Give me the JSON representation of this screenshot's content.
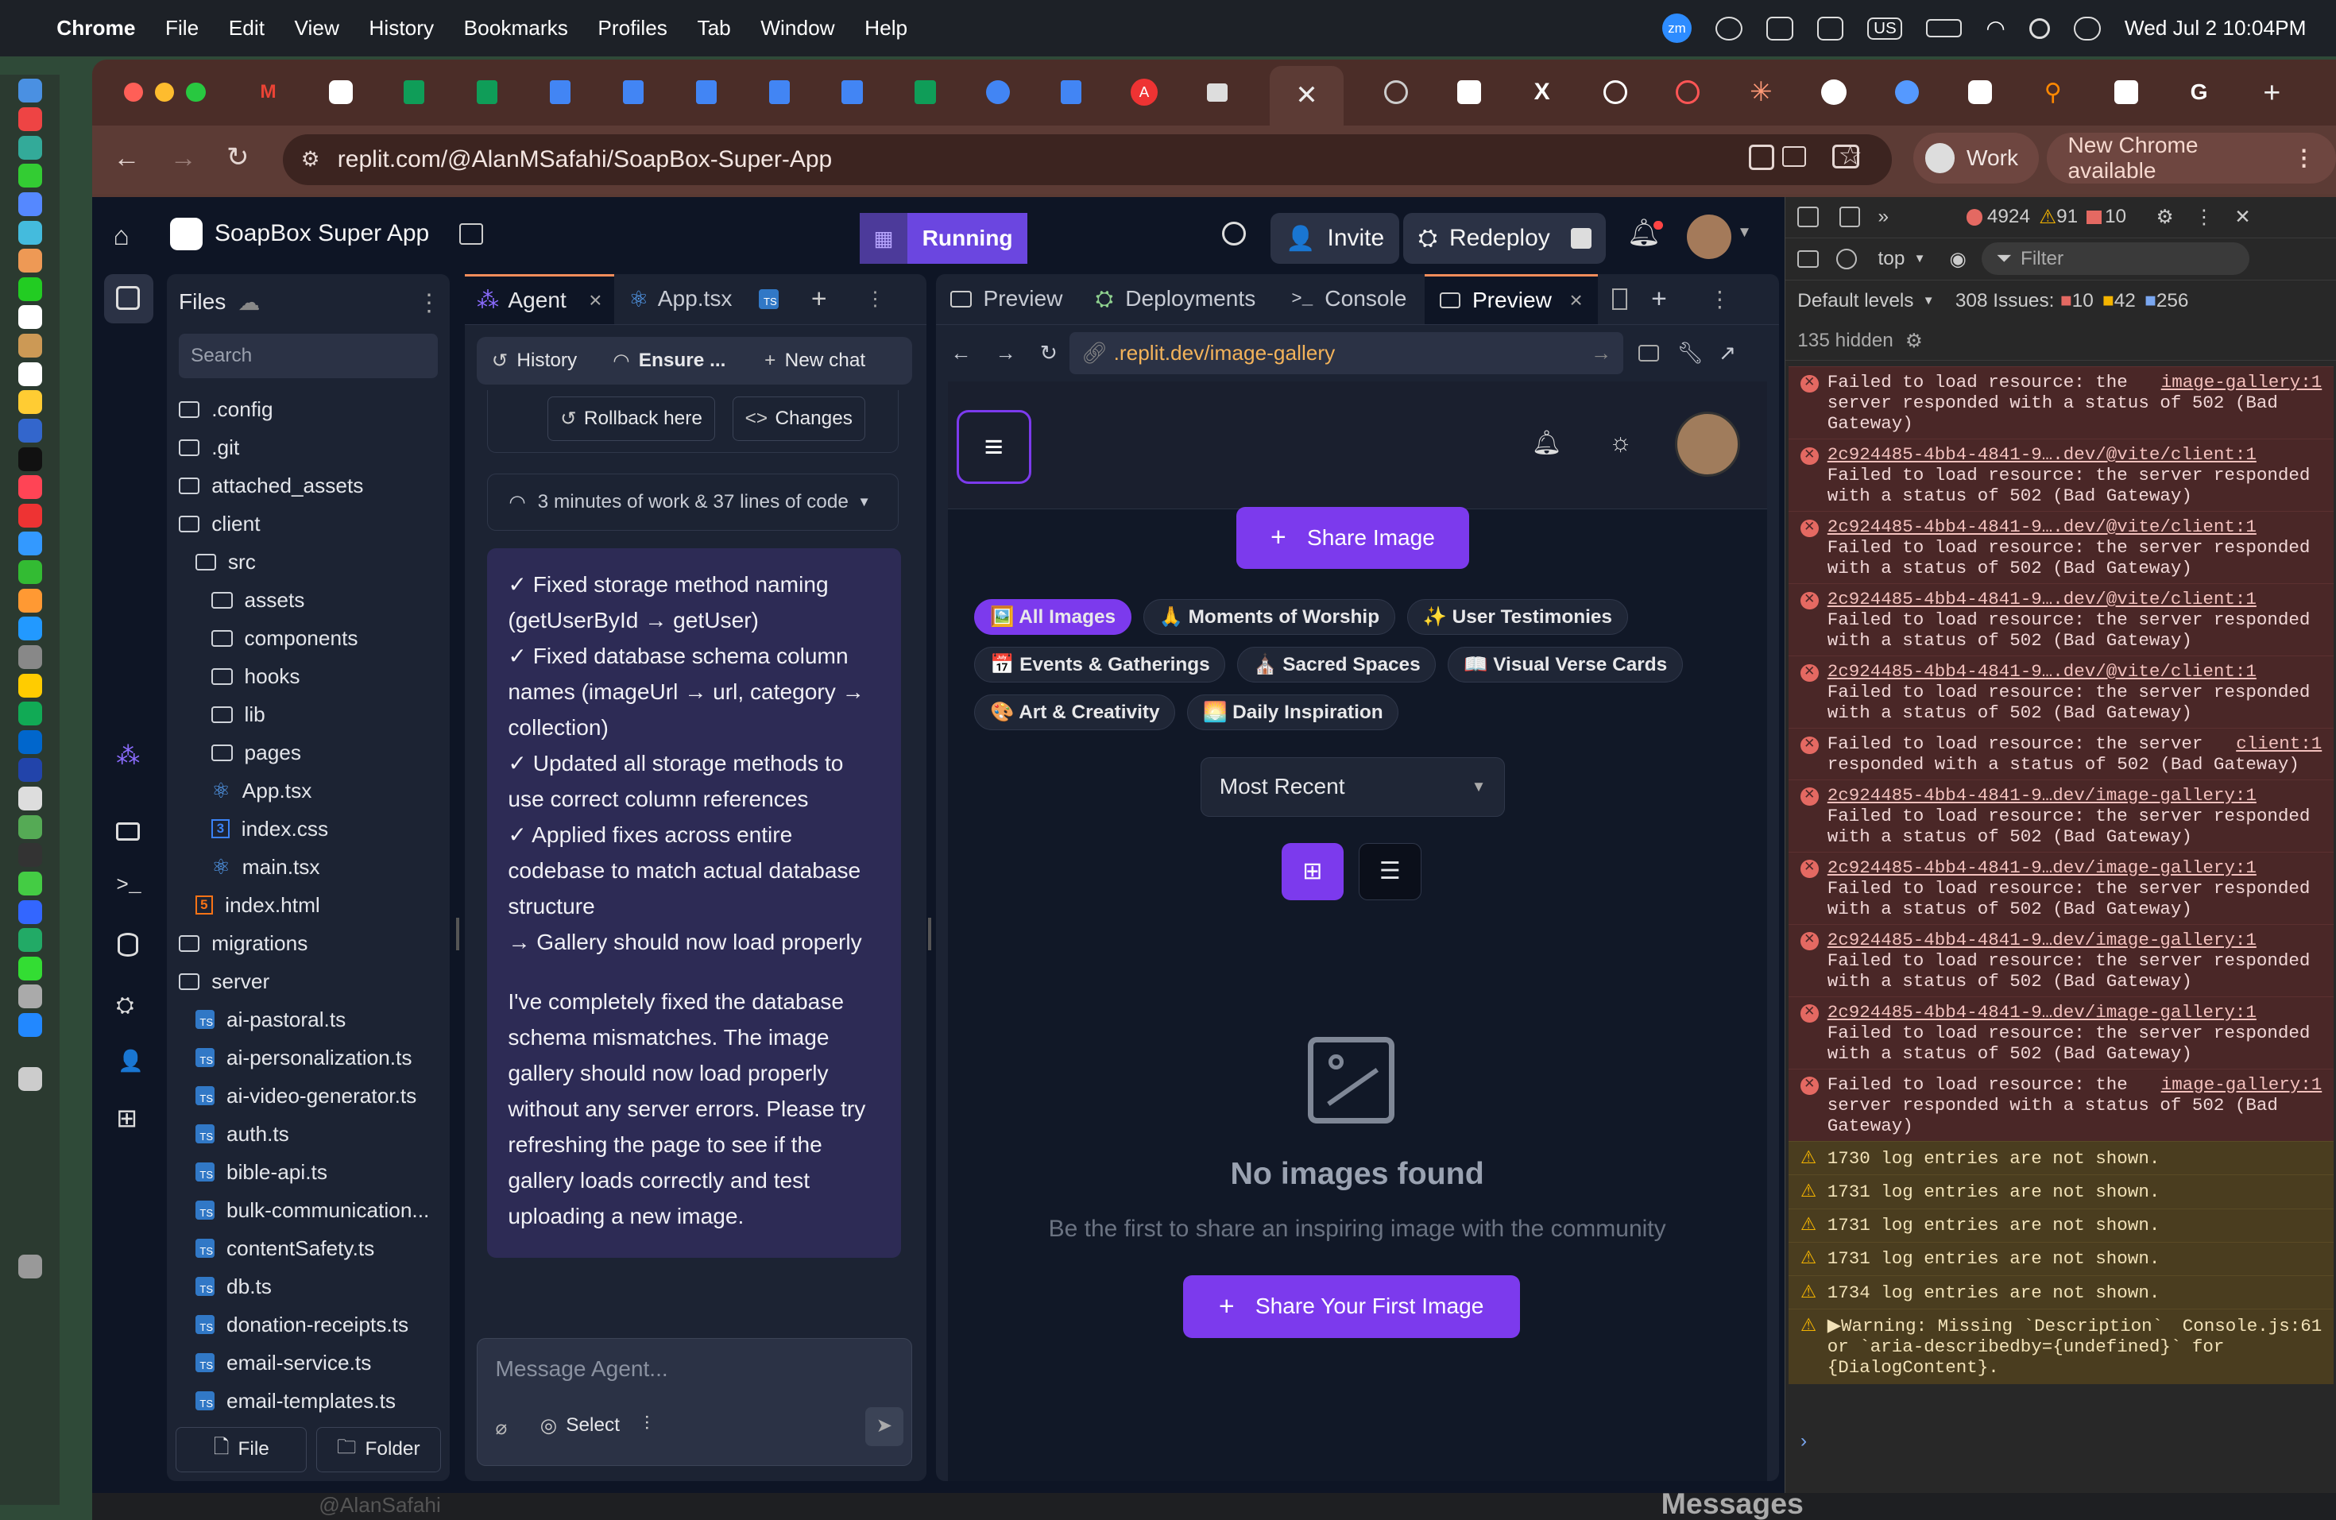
{
  "menubar": {
    "app": "Chrome",
    "items": [
      "File",
      "Edit",
      "View",
      "History",
      "Bookmarks",
      "Profiles",
      "Tab",
      "Window",
      "Help"
    ],
    "clock": "Wed Jul 2  10:04PM",
    "input_source": "US"
  },
  "browser": {
    "url": "replit.com/@AlanMSafahi/SoapBox-Super-App",
    "profile": "Work",
    "update_label": "New Chrome available"
  },
  "replit": {
    "app_name": "SoapBox Super App",
    "run_status": "Running",
    "invite_label": "Invite",
    "redeploy_label": "Redeploy",
    "files_title": "Files",
    "search_placeholder": "Search",
    "file_button": "File",
    "folder_button": "Folder",
    "files": [
      {
        "name": ".config",
        "type": "folder",
        "depth": 0
      },
      {
        "name": ".git",
        "type": "folder",
        "depth": 0
      },
      {
        "name": "attached_assets",
        "type": "folder",
        "depth": 0
      },
      {
        "name": "client",
        "type": "folder-open",
        "depth": 0
      },
      {
        "name": "src",
        "type": "folder-open",
        "depth": 1
      },
      {
        "name": "assets",
        "type": "folder",
        "depth": 2
      },
      {
        "name": "components",
        "type": "folder",
        "depth": 2
      },
      {
        "name": "hooks",
        "type": "folder",
        "depth": 2
      },
      {
        "name": "lib",
        "type": "folder",
        "depth": 2
      },
      {
        "name": "pages",
        "type": "folder",
        "depth": 2
      },
      {
        "name": "App.tsx",
        "type": "react",
        "depth": 2
      },
      {
        "name": "index.css",
        "type": "css",
        "depth": 2
      },
      {
        "name": "main.tsx",
        "type": "react",
        "depth": 2
      },
      {
        "name": "index.html",
        "type": "html",
        "depth": 1
      },
      {
        "name": "migrations",
        "type": "folder",
        "depth": 0
      },
      {
        "name": "server",
        "type": "folder-open",
        "depth": 0
      },
      {
        "name": "ai-pastoral.ts",
        "type": "ts",
        "depth": 1
      },
      {
        "name": "ai-personalization.ts",
        "type": "ts",
        "depth": 1
      },
      {
        "name": "ai-video-generator.ts",
        "type": "ts",
        "depth": 1
      },
      {
        "name": "auth.ts",
        "type": "ts",
        "depth": 1
      },
      {
        "name": "bible-api.ts",
        "type": "ts",
        "depth": 1
      },
      {
        "name": "bulk-communication...",
        "type": "ts",
        "depth": 1
      },
      {
        "name": "contentSafety.ts",
        "type": "ts",
        "depth": 1
      },
      {
        "name": "db.ts",
        "type": "ts",
        "depth": 1
      },
      {
        "name": "donation-receipts.ts",
        "type": "ts",
        "depth": 1
      },
      {
        "name": "email-service.ts",
        "type": "ts",
        "depth": 1
      },
      {
        "name": "email-templates.ts",
        "type": "ts",
        "depth": 1
      }
    ],
    "agent_tabs": {
      "agent": "Agent",
      "app": "App.tsx"
    },
    "agent": {
      "history": "History",
      "ensure": "Ensure ...",
      "new_chat": "New chat",
      "rollback": "Rollback here",
      "changes": "Changes",
      "work_summary": "3 minutes of work & 37 lines of code",
      "lines": [
        "✓ Fixed storage method naming (getUserById → getUser)",
        "✓ Fixed database schema column names (imageUrl → url, category → collection)",
        "✓ Updated all storage methods to use correct column references",
        "✓ Applied fixes across entire codebase to match actual database structure",
        "→ Gallery should now load properly"
      ],
      "paragraph": "I've completely fixed the database schema mismatches. The image gallery should now load properly without any server errors. Please try refreshing the page to see if the gallery loads correctly and test uploading a new image.",
      "input_placeholder": "Message Agent...",
      "select_label": "Select"
    },
    "preview_tabs": {
      "preview": "Preview",
      "deployments": "Deployments",
      "console": "Console",
      "preview2": "Preview"
    },
    "preview_url": ".replit.dev/image-gallery",
    "gallery": {
      "share_image": "Share Image",
      "categories": [
        {
          "label": "🖼️ All Images",
          "active": true
        },
        {
          "label": "🙏 Moments of Worship",
          "active": false
        },
        {
          "label": "✨ User Testimonies",
          "active": false
        },
        {
          "label": "📅 Events & Gatherings",
          "active": false
        },
        {
          "label": "⛪ Sacred Spaces",
          "active": false
        },
        {
          "label": "📖 Visual Verse Cards",
          "active": false
        },
        {
          "label": "🎨 Art & Creativity",
          "active": false
        },
        {
          "label": "🌅 Daily Inspiration",
          "active": false
        }
      ],
      "sort": "Most Recent",
      "empty_title": "No images found",
      "empty_sub": "Be the first to share an inspiring image with the community",
      "first_button": "Share Your First Image"
    }
  },
  "devtools": {
    "errors_count": "4924",
    "warnings_count": "91",
    "info_count": "10",
    "context": "top",
    "filter_placeholder": "Filter",
    "levels": "Default levels",
    "issues_label": "308 Issues:",
    "issues_err": "10",
    "issues_warn": "42",
    "issues_info": "256",
    "hidden": "135 hidden",
    "messages": [
      {
        "kind": "error",
        "text": "Failed to load resource: the server responded with a status of 502 (Bad Gateway)",
        "link": "image-gallery:1",
        "link_first": false
      },
      {
        "kind": "error",
        "text": "Failed to load resource: the server responded with a status of 502 (Bad Gateway)",
        "link": "2c924485-4bb4-4841-9….dev/@vite/client:1",
        "link_first": true
      },
      {
        "kind": "error",
        "text": "Failed to load resource: the server responded with a status of 502 (Bad Gateway)",
        "link": "2c924485-4bb4-4841-9….dev/@vite/client:1",
        "link_first": true
      },
      {
        "kind": "error",
        "text": "Failed to load resource: the server responded with a status of 502 (Bad Gateway)",
        "link": "2c924485-4bb4-4841-9….dev/@vite/client:1",
        "link_first": true
      },
      {
        "kind": "error",
        "text": "Failed to load resource: the server responded with a status of 502 (Bad Gateway)",
        "link": "2c924485-4bb4-4841-9….dev/@vite/client:1",
        "link_first": true
      },
      {
        "kind": "error",
        "text": "Failed to load resource: the server responded with a status of 502 (Bad Gateway)",
        "link": "client:1",
        "link_first": false
      },
      {
        "kind": "error",
        "text": "Failed to load resource: the server responded with a status of 502 (Bad Gateway)",
        "link": "2c924485-4bb4-4841-9…dev/image-gallery:1",
        "link_first": true
      },
      {
        "kind": "error",
        "text": "Failed to load resource: the server responded with a status of 502 (Bad Gateway)",
        "link": "2c924485-4bb4-4841-9…dev/image-gallery:1",
        "link_first": true
      },
      {
        "kind": "error",
        "text": "Failed to load resource: the server responded with a status of 502 (Bad Gateway)",
        "link": "2c924485-4bb4-4841-9…dev/image-gallery:1",
        "link_first": true
      },
      {
        "kind": "error",
        "text": "Failed to load resource: the server responded with a status of 502 (Bad Gateway)",
        "link": "2c924485-4bb4-4841-9…dev/image-gallery:1",
        "link_first": true
      },
      {
        "kind": "error",
        "text": "Failed to load resource: the server responded with a status of 502 (Bad Gateway)",
        "link": "image-gallery:1",
        "link_first": false
      },
      {
        "kind": "warn",
        "text": "1730 log entries are not shown."
      },
      {
        "kind": "warn",
        "text": "1731 log entries are not shown."
      },
      {
        "kind": "warn",
        "text": "1731 log entries are not shown."
      },
      {
        "kind": "warn",
        "text": "1731 log entries are not shown."
      },
      {
        "kind": "warn",
        "text": "1734 log entries are not shown."
      },
      {
        "kind": "warn",
        "text": "▶Warning: Missing `Description` or `aria-describedby={undefined}` for {DialogContent}.",
        "link": "Console.js:61",
        "link_first": false
      }
    ]
  },
  "background": {
    "messages": "Messages",
    "user": "@AlanSafahi"
  }
}
